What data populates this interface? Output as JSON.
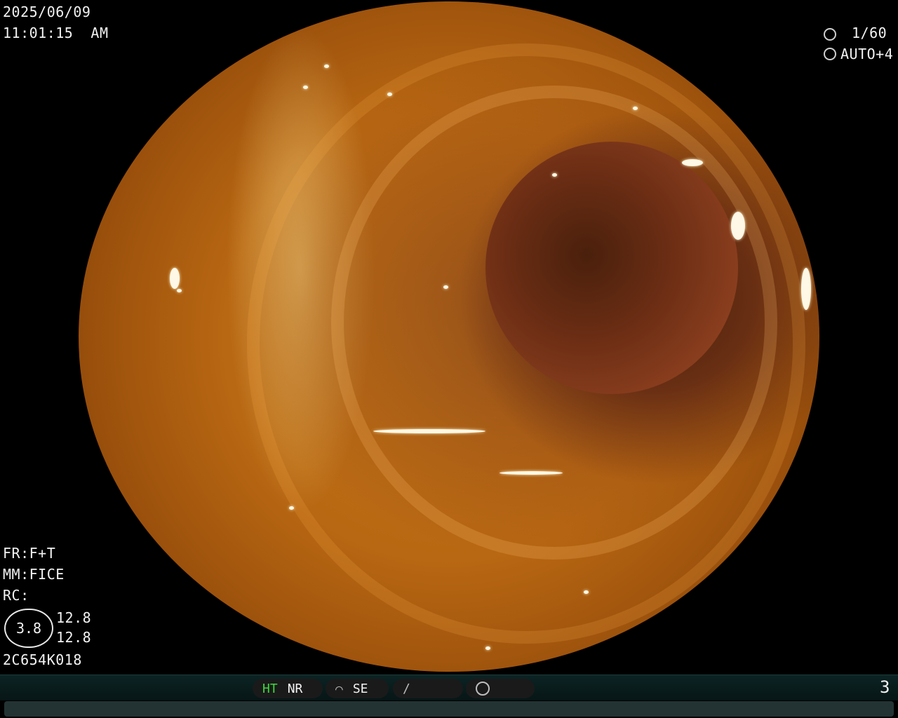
{
  "overlay": {
    "date": "2025/06/09",
    "time": "11:01:15  AM",
    "shutter": "1/60",
    "auto_exposure": "AUTO+4"
  },
  "settings": {
    "fr": "FR:F+T",
    "mm": "MM:FICE",
    "rc": "RC:",
    "ring_value": "3.8",
    "value_top": "12.8",
    "value_bottom": "12.8",
    "serial": "2C654K018"
  },
  "status_bar": {
    "ht": "HT",
    "nr": "NR",
    "se": "SE",
    "page": "3"
  },
  "icons": {
    "shutter": "shutter-icon",
    "auto": "aperture-icon",
    "structure": "structure-icon",
    "color": "color-icon",
    "mode": "mode-icon"
  }
}
